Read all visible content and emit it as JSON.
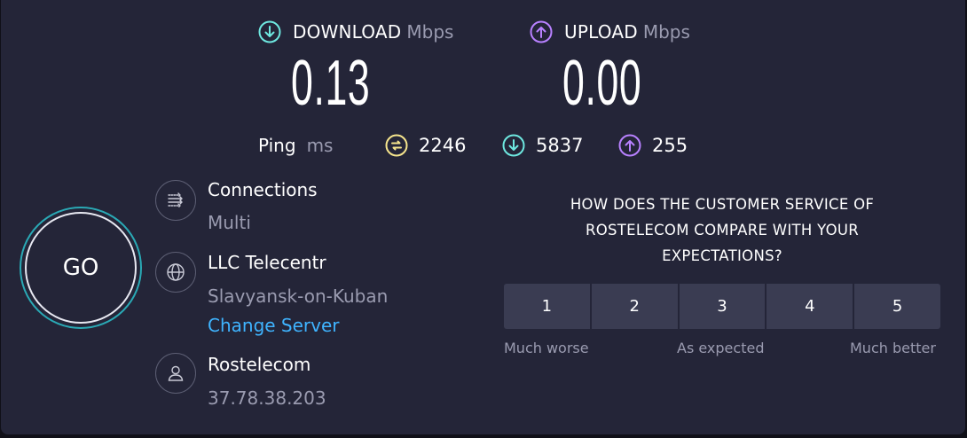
{
  "download": {
    "label": "DOWNLOAD",
    "unit": "Mbps",
    "value": "0.13",
    "icon": "arrow-down-circle-icon",
    "color": "#6ee8e0"
  },
  "upload": {
    "label": "UPLOAD",
    "unit": "Mbps",
    "value": "0.00",
    "icon": "arrow-up-circle-icon",
    "color": "#b881ff"
  },
  "ping": {
    "label": "Ping",
    "unit": "ms",
    "jitter": {
      "value": "2246",
      "icon": "jitter-icon",
      "color": "#f6e58d"
    },
    "download": {
      "value": "5837",
      "icon": "arrow-down-circle-icon",
      "color": "#6ee8e0"
    },
    "upload": {
      "value": "255",
      "icon": "arrow-up-circle-icon",
      "color": "#b881ff"
    }
  },
  "go_button": {
    "label": "GO"
  },
  "connections": {
    "title": "Connections",
    "value": "Multi",
    "icon": "connections-icon"
  },
  "server": {
    "title": "LLC Telecentr",
    "location": "Slavyansk-on-Kuban",
    "change_label": "Change Server",
    "icon": "globe-icon"
  },
  "provider": {
    "title": "Rostelecom",
    "ip": "37.78.38.203",
    "icon": "user-icon"
  },
  "survey": {
    "question": "HOW DOES THE CUSTOMER SERVICE OF ROSTELECOM COMPARE WITH YOUR EXPECTATIONS?",
    "options": [
      "1",
      "2",
      "3",
      "4",
      "5"
    ],
    "scale": {
      "low": "Much worse",
      "mid": "As expected",
      "high": "Much better"
    }
  }
}
